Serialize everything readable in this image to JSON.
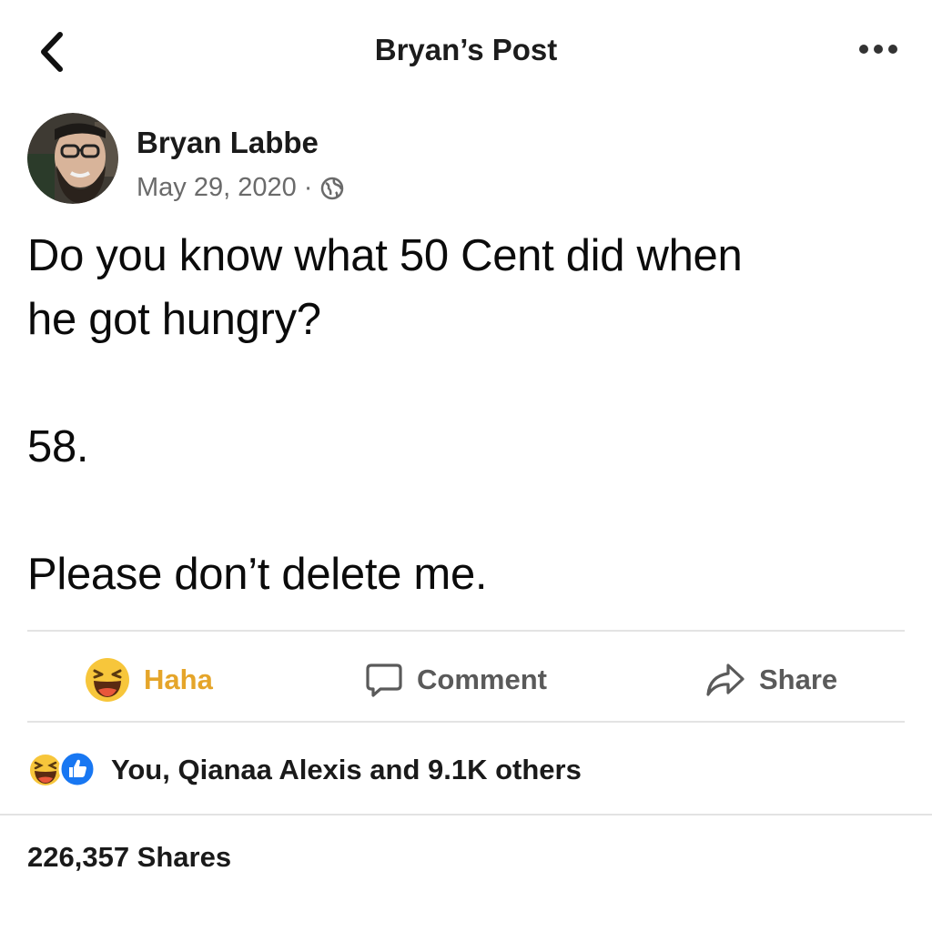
{
  "top_bar": {
    "title": "Bryan’s Post",
    "back_icon": "chevron-left-icon",
    "more_icon": "more-horizontal-icon"
  },
  "post": {
    "author": "Bryan Labbe",
    "timestamp": "May 29, 2020",
    "separator": "·",
    "privacy_icon": "globe-icon",
    "body_lines": [
      "Do you know what 50 Cent did when",
      "he got hungry?",
      "58.",
      "Please don’t delete me."
    ]
  },
  "actions": {
    "haha_label": "Haha",
    "comment_label": "Comment",
    "share_label": "Share"
  },
  "reactions": {
    "icons": [
      "haha-reaction-icon",
      "like-reaction-icon"
    ],
    "summary": "You, Qianaa Alexis and 9.1K others"
  },
  "shares": {
    "label": "226,357 Shares"
  },
  "colors": {
    "haha_accent": "#e5a52a",
    "like_blue": "#1877f2",
    "muted_text": "#6a6a6a",
    "divider": "#e3e3e3"
  }
}
